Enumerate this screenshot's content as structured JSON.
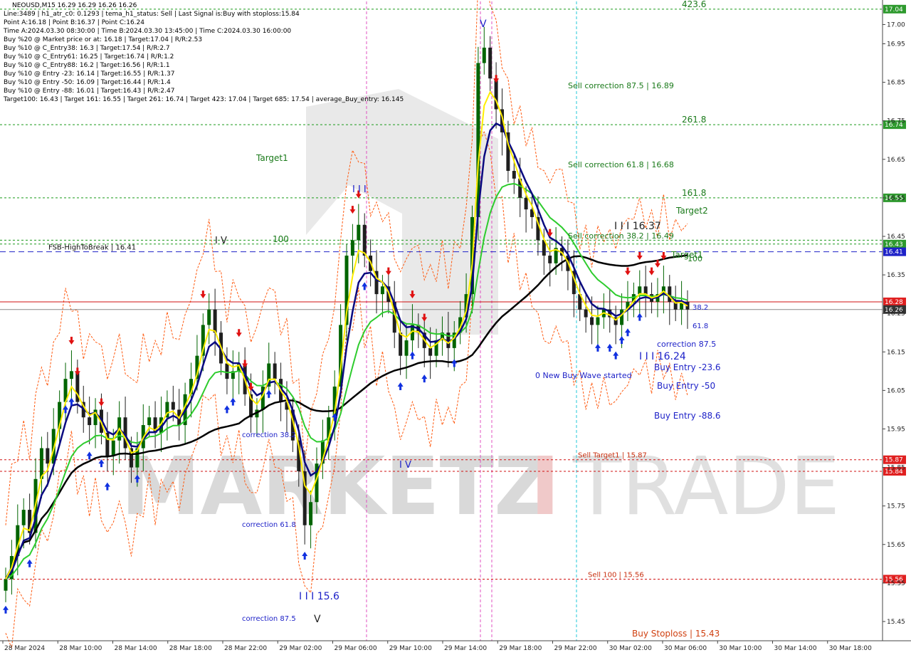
{
  "header": {
    "symbol_line": "NEOUSD,M15  16.29 16.29 16.26 16.26",
    "info_lines": [
      "Line:3489  |  h1_atr_c0: 0.1293  |  tema_h1_status: Sell  |  Last Signal is:Buy with stoploss:15.84",
      "Point A:16.18  |  Point B:16.37  |  Point C:16.24",
      "Time A:2024.03.30 08:30:00  |  Time B:2024.03.30 13:45:00  |  Time C:2024.03.30 16:00:00",
      "Buy %20 @ Market price or at: 16.18  |  Target:17.04  |  R/R:2.53",
      "Buy %10 @ C_Entry38: 16.3  |  Target:17.54  |  R/R:2.7",
      "Buy %10 @ C_Entry61: 16.25  |  Target:16.74  |  R/R:1.2",
      "Buy %10 @ C_Entry88: 16.2  |  Target:16.56  |  R/R:1.1",
      "Buy %10 @ Entry -23: 16.14  |  Target:16.55  |  R/R:1.37",
      "Buy %10 @ Entry -50: 16.09  |  Target:16.44  |  R/R:1.4",
      "Buy %10 @ Entry -88: 16.01  |  Target:16.43  |  R/R:2.47",
      "Target100: 16.43  |  Target 161: 16.55  |  Target 261: 16.74  |  Target 423: 17.04  |  Target 685: 17.54  |  average_Buy_entry: 16.145"
    ]
  },
  "watermark": {
    "text_a": "MARKETZ",
    "text_b": "I",
    "text_c": "TRADE"
  },
  "colors": {
    "bg": "#ffffff",
    "grid": "#e4e4e4",
    "up": "#006400",
    "down": "#1f1f1f",
    "green_dash": "#1a9a1a",
    "blue_dash": "#1e22c8",
    "red_line": "#d01010",
    "orange_dash": "#ff5a10",
    "magenta": "#e050c0",
    "cyan": "#20c8d8",
    "yellow": "#ffee00",
    "navy": "#0a0a80",
    "ma_green": "#2ecc2e",
    "black": "#000000",
    "label_green_bg": "#2e9a2e",
    "label_blue_bg": "#1e22c8",
    "label_red_bg": "#e02020",
    "label_gray_bg": "#333333",
    "label_lt_red_bg": "#ff5050"
  },
  "chart_data": {
    "type": "candlestick",
    "symbol": "NEOUSD",
    "timeframe": "M15",
    "ylim": [
      15.4,
      17.06
    ],
    "y_ticks": [
      17.0,
      16.95,
      16.85,
      16.75,
      16.65,
      16.55,
      16.45,
      16.35,
      16.25,
      16.15,
      16.05,
      15.95,
      15.85,
      15.75,
      15.65,
      15.55,
      15.45
    ],
    "x_ticks": [
      "28 Mar 2024",
      "28 Mar 10:00",
      "28 Mar 14:00",
      "28 Mar 18:00",
      "28 Mar 22:00",
      "29 Mar 02:00",
      "29 Mar 06:00",
      "29 Mar 10:00",
      "29 Mar 14:00",
      "29 Mar 18:00",
      "29 Mar 22:00",
      "30 Mar 02:00",
      "30 Mar 06:00",
      "30 Mar 10:00",
      "30 Mar 14:00",
      "30 Mar 18:00"
    ],
    "closes": [
      15.56,
      15.62,
      15.7,
      15.74,
      15.68,
      15.82,
      15.9,
      15.86,
      15.95,
      16.02,
      16.08,
      16.1,
      16.02,
      15.98,
      15.96,
      16.0,
      15.94,
      15.88,
      15.92,
      15.98,
      15.9,
      15.85,
      15.9,
      15.96,
      15.98,
      15.94,
      15.98,
      16.02,
      16.0,
      15.96,
      16.04,
      16.08,
      16.14,
      16.22,
      16.26,
      16.2,
      16.12,
      16.08,
      16.1,
      16.12,
      16.04,
      15.98,
      16.0,
      16.06,
      16.12,
      16.08,
      16.02,
      16.0,
      15.92,
      15.84,
      15.7,
      15.76,
      15.86,
      15.92,
      15.98,
      16.06,
      16.22,
      16.4,
      16.44,
      16.48,
      16.4,
      16.36,
      16.3,
      16.32,
      16.28,
      16.2,
      16.14,
      16.18,
      16.22,
      16.2,
      16.16,
      16.14,
      16.18,
      16.2,
      16.16,
      16.2,
      16.24,
      16.3,
      16.5,
      16.9,
      16.94,
      16.86,
      16.78,
      16.72,
      16.62,
      16.6,
      16.55,
      16.52,
      16.5,
      16.44,
      16.4,
      16.38,
      16.42,
      16.4,
      16.36,
      16.3,
      16.26,
      16.24,
      16.22,
      16.24,
      16.26,
      16.24,
      16.22,
      16.26,
      16.28,
      16.3,
      16.32,
      16.3,
      16.28,
      16.3,
      16.32,
      16.28,
      16.26,
      16.28,
      16.26
    ],
    "horizontal_levels": [
      {
        "name": "target-423",
        "value": 17.04,
        "style": "green_dash",
        "label": "423.6",
        "tag": "17.04"
      },
      {
        "name": "target-261",
        "value": 16.74,
        "style": "green_dash",
        "label": "261.8",
        "tag": "16.74"
      },
      {
        "name": "target-161",
        "value": 16.55,
        "style": "green_dash",
        "label": "161.8",
        "tag": "16.55"
      },
      {
        "name": "target-100",
        "value": 16.43,
        "style": "green_dash",
        "label": "100",
        "tag": "16.43"
      },
      {
        "name": "target-100b",
        "value": 16.44,
        "style": "green_dash",
        "label": "",
        "tag": ""
      },
      {
        "name": "fsb-high",
        "value": 16.41,
        "style": "blue_dash",
        "label": "FSB-HighToBreak  |  16.41",
        "tag": "16.41"
      },
      {
        "name": "current-price",
        "value": 16.28,
        "style": "red_line",
        "label": "",
        "tag": "16.28"
      },
      {
        "name": "bid-price",
        "value": 16.26,
        "style": "gray_line",
        "label": "",
        "tag": "16.26"
      },
      {
        "name": "sell-target1",
        "value": 15.87,
        "style": "red_dash",
        "label": "Sell Target1  |  15.87",
        "tag": "15.87"
      },
      {
        "name": "stoploss",
        "value": 15.84,
        "style": "red_dash",
        "label": "",
        "tag": "15.84"
      },
      {
        "name": "sell-100",
        "value": 15.56,
        "style": "red_dash",
        "label": "Sell 100  |  15.56",
        "tag": "15.56"
      }
    ],
    "annotations": {
      "sell_corr_875": "Sell correction 87.5  |  16.89",
      "sell_corr_618": "Sell correction 61.8  |  16.68",
      "sell_corr_382": "Sell correction 38.2  |  16.49",
      "target1_left": "Target1",
      "target2": "Target2",
      "target1_right": "Target1",
      "hundred_right": "100",
      "wave_iii_16_37": "I I I  16.37",
      "wave_iii_16_24": "I I I  16.24",
      "wave_iii_15_6": "I I I  15.6",
      "wave_v_top": "V",
      "wave_iii_top": "I I I",
      "wave_iv_left": "I V",
      "wave_iv_mid": "I V",
      "wave_v_bottom": "V",
      "new_buy_wave": "0 New Buy Wave started",
      "corr_382_left": "correction 38.2",
      "corr_618_left": "correction 61.8",
      "corr_875_left": "correction 87.5",
      "corr_382_right": "38.2",
      "corr_618_right": "61.8",
      "corr_875_right": "correction 87.5",
      "buy_entry_23": "Buy Entry -23.6",
      "buy_entry_50": "Buy Entry -50",
      "buy_entry_88": "Buy Entry -88.6",
      "buy_stoploss": "Buy Stoploss  |  15.43"
    }
  }
}
